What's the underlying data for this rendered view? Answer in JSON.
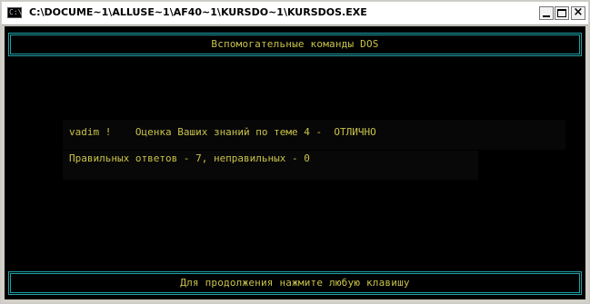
{
  "window": {
    "title": "C:\\DOCUME~1\\ALLUSE~1\\AF40~1\\KURSDO~1\\KURSDOS.EXE",
    "icon": "console-icon",
    "icon_glyph": "C:\\"
  },
  "console": {
    "header": "Вспомогательные команды DOS",
    "result_line": "vadim !    Оценка Ваших знаний по теме 4 -  ОТЛИЧНО",
    "stats_line": "Правильных ответов - 7, неправильных - 0",
    "footer": "Для продолжения нажмите любую клавишу"
  },
  "colors": {
    "console_bg": "#000000",
    "text": "#c9c24a",
    "frame": "#1fa0a8"
  }
}
